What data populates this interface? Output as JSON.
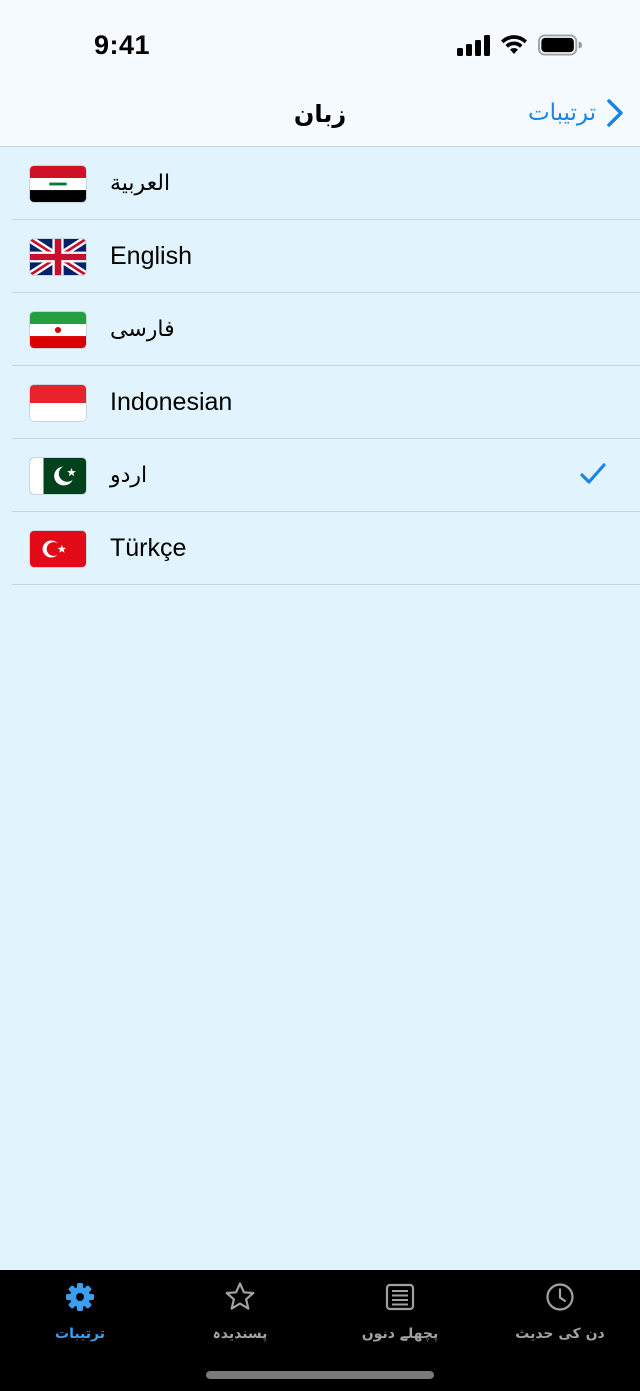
{
  "status_bar": {
    "time": "9:41"
  },
  "nav": {
    "title": "زبان",
    "back_label": "ترتیبات"
  },
  "languages": [
    {
      "label": "العربية",
      "flag": "iraq-flag",
      "rtl": true,
      "selected": false
    },
    {
      "label": "English",
      "flag": "uk-flag",
      "rtl": false,
      "selected": false
    },
    {
      "label": "فارسی",
      "flag": "iran-flag",
      "rtl": true,
      "selected": false
    },
    {
      "label": "Indonesian",
      "flag": "indonesia-flag",
      "rtl": false,
      "selected": false
    },
    {
      "label": "اردو",
      "flag": "pakistan-flag",
      "rtl": true,
      "selected": true
    },
    {
      "label": "Türkçe",
      "flag": "turkey-flag",
      "rtl": false,
      "selected": false
    }
  ],
  "tabs": [
    {
      "label": "ترتیبات",
      "icon": "gear-icon",
      "active": true
    },
    {
      "label": "پسندیدہ",
      "icon": "star-icon",
      "active": false
    },
    {
      "label": "پچھلے دنوں",
      "icon": "list-icon",
      "active": false
    },
    {
      "label": "دن کی حدیث",
      "icon": "clock-icon",
      "active": false
    }
  ],
  "colors": {
    "accent": "#1a85e8",
    "background": "#e1f4fd",
    "tab_active": "#3a9ff0",
    "tab_inactive": "#a2a2a2"
  }
}
